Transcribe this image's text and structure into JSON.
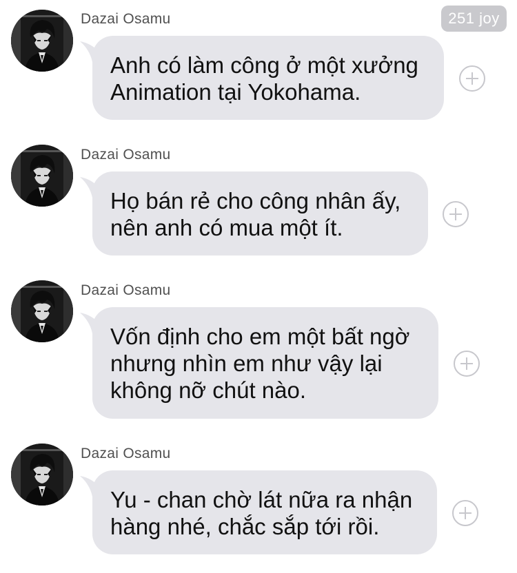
{
  "header": {
    "badge_text": "251 joy"
  },
  "messages": [
    {
      "sender": "Dazai Osamu",
      "lines": [
        "Anh có làm công ở một xưởng",
        "Animation tại Yokohama."
      ],
      "avatar_icon": "avatar-anime-character-icon",
      "action_icon": "add-reaction-icon"
    },
    {
      "sender": "Dazai Osamu",
      "lines": [
        "Họ bán rẻ cho công nhân ấy,",
        "nên anh có mua một ít."
      ],
      "avatar_icon": "avatar-anime-character-icon",
      "action_icon": "add-reaction-icon"
    },
    {
      "sender": "Dazai Osamu",
      "lines": [
        "Vốn định cho em một bất ngờ",
        "nhưng nhìn em như vậy lại",
        "không nỡ chút nào."
      ],
      "avatar_icon": "avatar-anime-character-icon",
      "action_icon": "add-reaction-icon"
    },
    {
      "sender": "Dazai Osamu",
      "lines": [
        "Yu - chan chờ lát nữa ra nhận",
        "hàng nhé, chắc sắp tới rồi."
      ],
      "avatar_icon": "avatar-anime-character-icon",
      "action_icon": "add-reaction-icon"
    }
  ],
  "colors": {
    "bubble_background": "#e5e5ea",
    "badge_background": "#c9c9cd",
    "sender_text": "#505050",
    "message_text": "#111111",
    "action_icon": "#c7c7cc"
  }
}
